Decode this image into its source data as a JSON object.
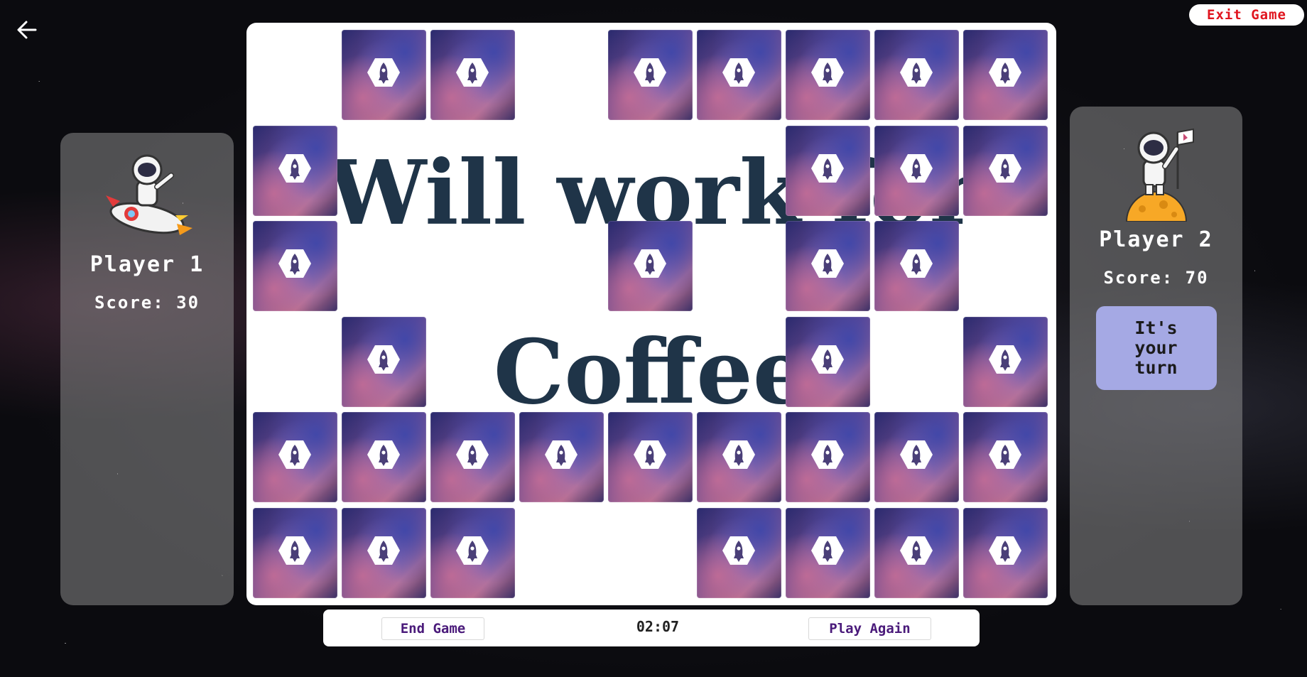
{
  "header": {
    "exit_label": "Exit Game",
    "back_icon": "arrow-left-icon"
  },
  "players": [
    {
      "name": "Player 1",
      "score": "Score: 30",
      "avatar": "astronaut-rocket-icon"
    },
    {
      "name": "Player 2",
      "score": "Score: 70",
      "avatar": "astronaut-moon-flag-icon",
      "turn": "It's\nyour\nturn"
    }
  ],
  "board": {
    "background_text": [
      "Will work for",
      "Coffee"
    ],
    "card_icon": "rocket-hexagon-icon",
    "face_down_cards": [
      [
        1,
        2,
        4,
        5,
        6,
        7,
        8
      ],
      [
        0,
        6,
        7,
        8
      ],
      [
        0,
        4,
        6,
        7
      ],
      [
        1,
        6,
        8
      ],
      [
        0,
        1,
        2,
        3,
        4,
        5,
        6,
        7,
        8
      ],
      [
        0,
        1,
        2,
        5,
        6,
        7,
        8
      ]
    ]
  },
  "footer": {
    "end_label": "End Game",
    "timer": "02:07",
    "again_label": "Play Again"
  },
  "colors": {
    "exit_text": "#e0141e",
    "turn_bg": "#a5a9e4",
    "board_text": "#1f3448",
    "button_text": "#4a1a7a"
  }
}
